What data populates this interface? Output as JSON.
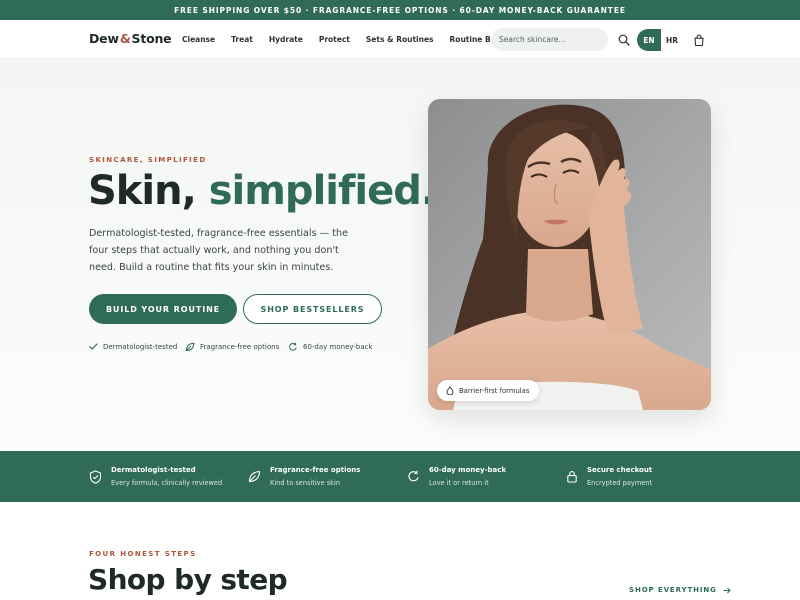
{
  "announcement": "FREE SHIPPING OVER $50 · FRAGRANCE-FREE OPTIONS · 60-DAY MONEY-BACK GUARANTEE",
  "header": {
    "logo_part1": "Dew",
    "logo_amp": "&",
    "logo_part2": "Stone",
    "nav": [
      "Cleanse",
      "Treat",
      "Hydrate",
      "Protect",
      "Sets & Routines",
      "Routine Builder"
    ],
    "search_placeholder": "Search skincare...",
    "lang_active": "EN",
    "lang_other": "HR"
  },
  "hero": {
    "eyebrow": "SKINCARE, SIMPLIFIED",
    "headline_part1": "Skin,",
    "headline_part2": "simplified.",
    "lede": "Dermatologist-tested, fragrance-free essentials — the four steps that actually work, and nothing you don't need. Build a routine that fits your skin in minutes.",
    "cta_primary": "BUILD YOUR ROUTINE",
    "cta_secondary": "SHOP BESTSELLERS",
    "trust": [
      "Dermatologist-tested",
      "Fragrance-free options",
      "60-day money-back"
    ],
    "photo_badge": "Barrier-first formulas"
  },
  "features": [
    {
      "title": "Dermatologist-tested",
      "subtitle": "Every formula, clinically reviewed",
      "icon": "shield-check-icon"
    },
    {
      "title": "Fragrance-free options",
      "subtitle": "Kind to sensitive skin",
      "icon": "leaf-icon"
    },
    {
      "title": "60-day money-back",
      "subtitle": "Love it or return it",
      "icon": "refresh-icon"
    },
    {
      "title": "Secure checkout",
      "subtitle": "Encrypted payment",
      "icon": "lock-icon"
    }
  ],
  "steps_section": {
    "eyebrow": "FOUR HONEST STEPS",
    "title": "Shop by step",
    "link": "SHOP EVERYTHING"
  },
  "colors": {
    "brand_green": "#2f6b58",
    "accent_terracotta": "#b0553a",
    "ink": "#1f2a27"
  }
}
